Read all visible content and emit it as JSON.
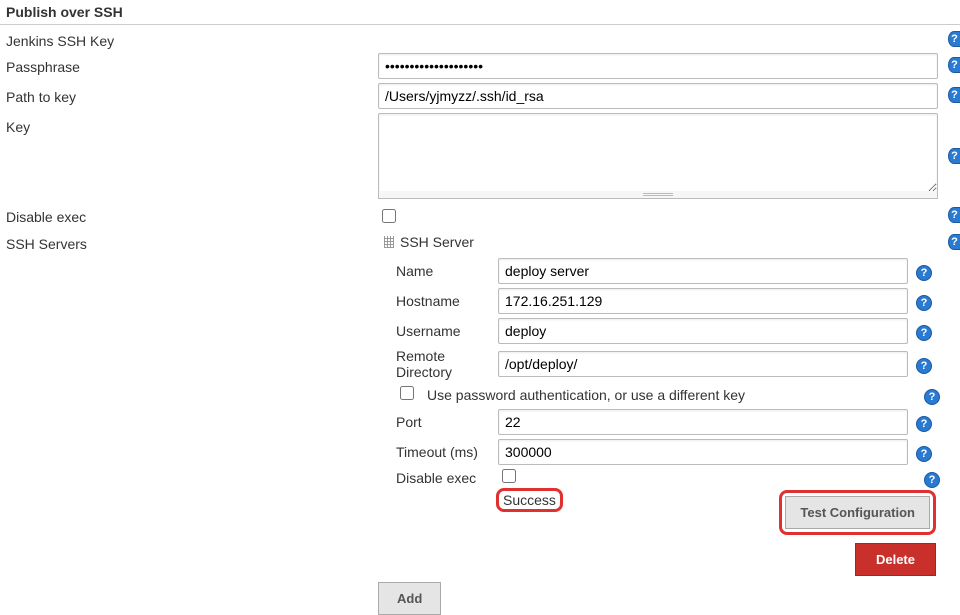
{
  "section_title": "Publish over SSH",
  "labels": {
    "jenkins_ssh_key": "Jenkins SSH Key",
    "passphrase": "Passphrase",
    "path_to_key": "Path to key",
    "key": "Key",
    "disable_exec": "Disable exec",
    "ssh_servers": "SSH Servers"
  },
  "fields": {
    "passphrase_value": "••••••••••••••••••••",
    "path_to_key_value": "/Users/yjmyzz/.ssh/id_rsa",
    "key_value": ""
  },
  "server": {
    "header": "SSH Server",
    "labels": {
      "name": "Name",
      "hostname": "Hostname",
      "username": "Username",
      "remote_directory": "Remote Directory",
      "use_password_auth": "Use password authentication, or use a different key",
      "port": "Port",
      "timeout": "Timeout (ms)",
      "disable_exec": "Disable exec"
    },
    "values": {
      "name": "deploy server",
      "hostname": "172.16.251.129",
      "username": "deploy",
      "remote_directory": "/opt/deploy/",
      "port": "22",
      "timeout": "300000"
    },
    "status": "Success"
  },
  "buttons": {
    "test_configuration": "Test Configuration",
    "delete": "Delete",
    "add": "Add"
  },
  "help_glyph": "?"
}
